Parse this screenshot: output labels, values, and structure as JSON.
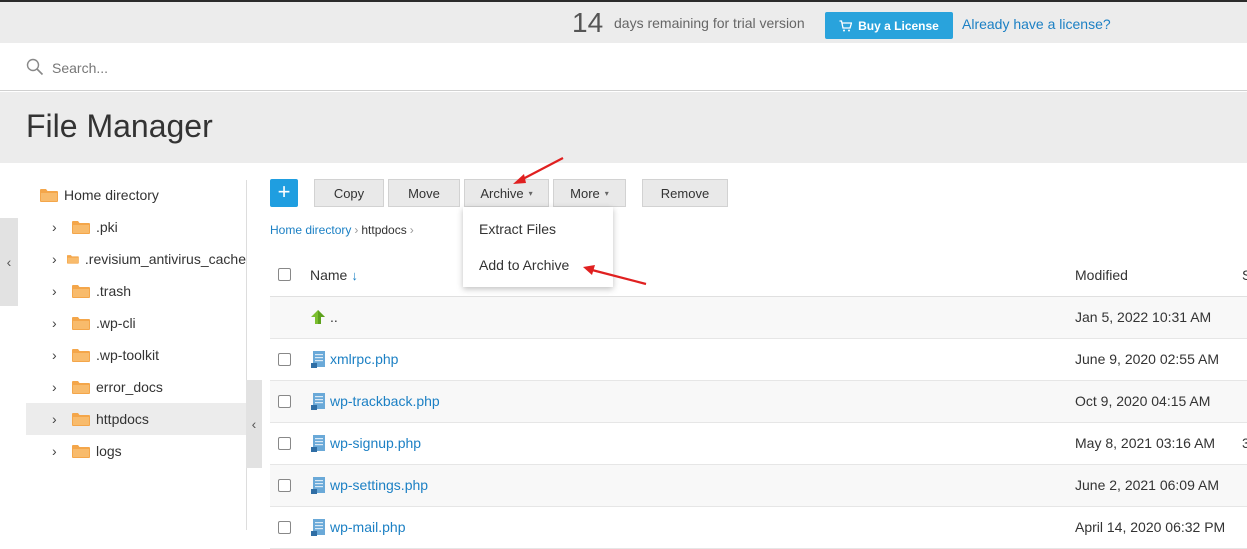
{
  "trial": {
    "days": "14",
    "text": "days remaining for trial version",
    "buy_label": "Buy a License",
    "have_license": "Already have a license?"
  },
  "search": {
    "placeholder": "Search..."
  },
  "page": {
    "title": "File Manager"
  },
  "tree": {
    "root": "Home directory",
    "items": [
      ".pki",
      ".revisium_antivirus_cache",
      ".trash",
      ".wp-cli",
      ".wp-toolkit",
      "error_docs",
      "httpdocs",
      "logs"
    ],
    "selected": "httpdocs"
  },
  "toolbar": {
    "add": "+",
    "copy": "Copy",
    "move": "Move",
    "archive": "Archive",
    "more": "More",
    "remove": "Remove"
  },
  "archive_menu": {
    "items": [
      "Extract Files",
      "Add to Archive"
    ]
  },
  "breadcrumb": {
    "home": "Home directory",
    "current": "httpdocs"
  },
  "table": {
    "headers": {
      "name": "Name",
      "sort": "↓",
      "modified": "Modified",
      "extra": "S"
    },
    "rows": [
      {
        "name": "..",
        "modified": "Jan 5, 2022 10:31 AM",
        "extra": ""
      },
      {
        "name": "xmlrpc.php",
        "modified": "June 9, 2020 02:55 AM",
        "extra": ""
      },
      {
        "name": "wp-trackback.php",
        "modified": "Oct 9, 2020 04:15 AM",
        "extra": ""
      },
      {
        "name": "wp-signup.php",
        "modified": "May 8, 2021 03:16 AM",
        "extra": "3"
      },
      {
        "name": "wp-settings.php",
        "modified": "June 2, 2021 06:09 AM",
        "extra": ""
      },
      {
        "name": "wp-mail.php",
        "modified": "April 14, 2020 06:32 PM",
        "extra": ""
      }
    ]
  },
  "icons": {
    "cart": "cart-icon",
    "search": "search-icon",
    "folder": "folder-icon",
    "file": "php-file-icon",
    "up": "up-arrow-icon"
  },
  "colors": {
    "accent": "#29a3dc",
    "link": "#1c80c4",
    "folder": "#f4a64a",
    "annotation": "#e02020"
  }
}
